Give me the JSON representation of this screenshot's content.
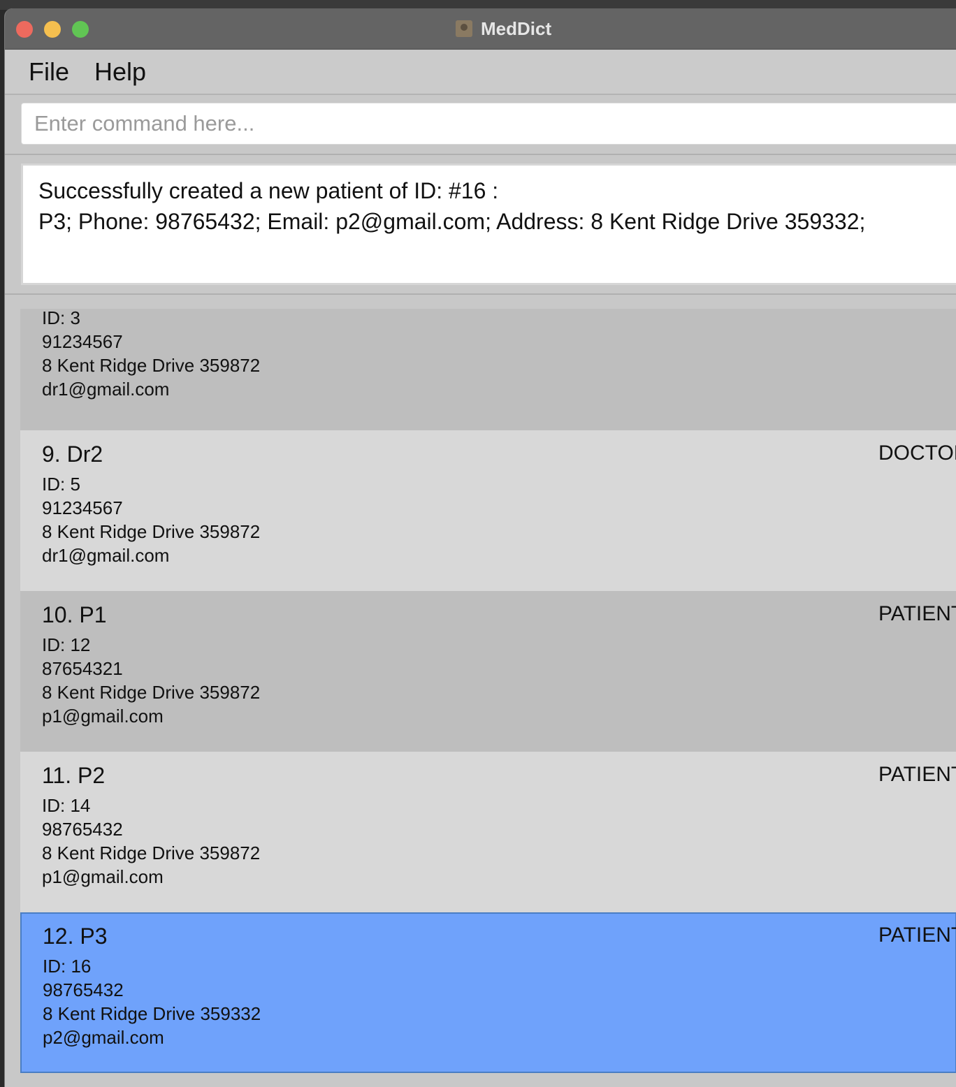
{
  "window": {
    "title": "MedDict"
  },
  "menu": {
    "file": "File",
    "help": "Help"
  },
  "command": {
    "placeholder": "Enter command here...",
    "value": ""
  },
  "result": {
    "lines": [
      "Successfully created a new patient of ID: #16 :",
      "P3; Phone: 98765432; Email: p2@gmail.com; Address: 8 Kent Ridge Drive 359332;"
    ]
  },
  "persons": [
    {
      "name": "",
      "role": "",
      "id": "ID: 3",
      "phone": "91234567",
      "address": "8 Kent Ridge Drive 359872",
      "email": "dr1@gmail.com"
    },
    {
      "name": "9. Dr2",
      "role": "DOCTOR",
      "id": "ID: 5",
      "phone": "91234567",
      "address": "8 Kent Ridge Drive 359872",
      "email": "dr1@gmail.com"
    },
    {
      "name": "10. P1",
      "role": "PATIENT",
      "id": "ID: 12",
      "phone": "87654321",
      "address": "8 Kent Ridge Drive 359872",
      "email": "p1@gmail.com"
    },
    {
      "name": "11. P2",
      "role": "PATIENT",
      "id": "ID: 14",
      "phone": "98765432",
      "address": "8 Kent Ridge Drive 359872",
      "email": "p1@gmail.com"
    },
    {
      "name": "12. P3",
      "role": "PATIENT",
      "id": "ID: 16",
      "phone": "98765432",
      "address": "8 Kent Ridge Drive 359332",
      "email": "p2@gmail.com"
    }
  ]
}
